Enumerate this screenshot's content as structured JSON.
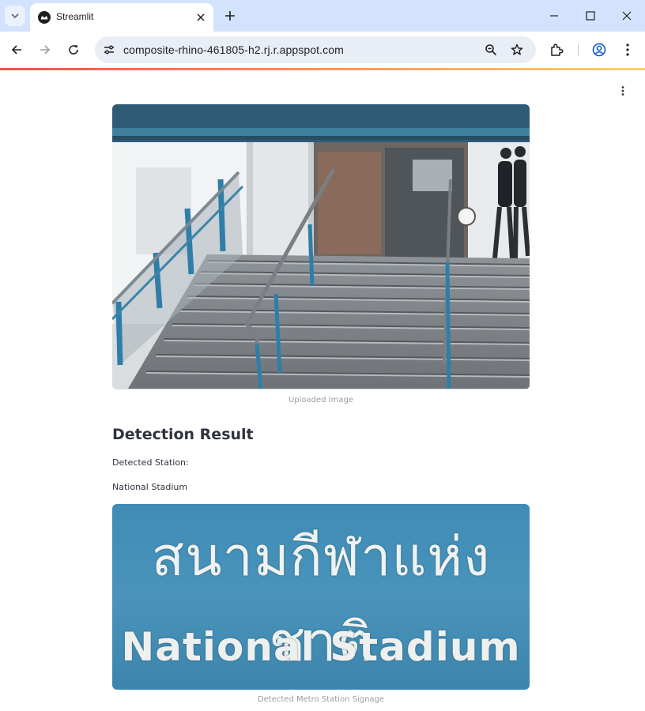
{
  "browser": {
    "tab_title": "Streamlit",
    "url": "composite-rhino-461805-h2.rj.r.appspot.com",
    "icons": [
      "tab-search-icon",
      "streamlit-favicon",
      "close-icon",
      "plus-icon",
      "minimize-icon",
      "maximize-icon",
      "window-close-icon",
      "back-arrow-icon",
      "forward-arrow-icon",
      "reload-icon",
      "site-info-icon",
      "zoom-icon",
      "star-icon",
      "extensions-icon",
      "profile-icon",
      "kebab-menu-icon"
    ]
  },
  "app": {
    "uploaded_caption": "Uploaded Image",
    "heading": "Detection Result",
    "detected_label": "Detected Station:",
    "station_name": "National Stadium",
    "signage_caption": "Detected Metro Station Signage",
    "signage_thai": "สนามกีฬาแห่งชาติ",
    "signage_english": "National  Stadium"
  },
  "colors": {
    "tabbar": "#d3e3fd",
    "omnibox": "#e9eef6",
    "text": "#31333f",
    "caption": "#9a9ca3",
    "sign_blue": "#4a94bb",
    "accent": "#ff4b4b"
  }
}
